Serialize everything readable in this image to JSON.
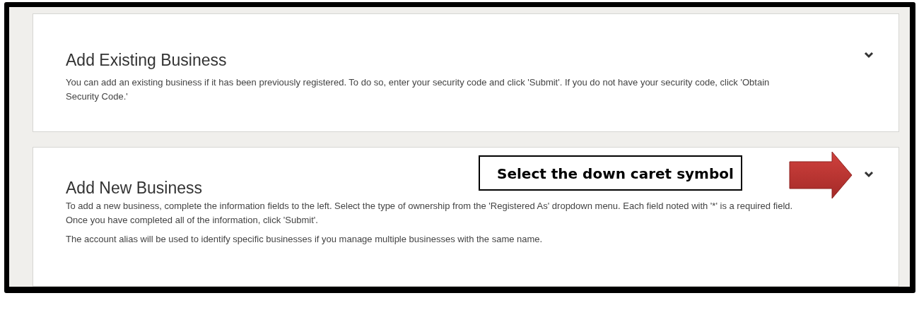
{
  "panels": [
    {
      "title": "Add Existing Business",
      "paragraphs": [
        "You can add an existing business if it has been previously registered. To do so, enter your security code and click 'Submit'. If you do not have your security code, click 'Obtain Security Code.'"
      ],
      "expanded": false
    },
    {
      "title": "Add New Business",
      "paragraphs": [
        "To add a new business, complete the information fields to the left. Select the type of ownership from the 'Registered As' dropdown menu. Each field noted with '*' is a required field. Once you have completed all of the information, click 'Submit'.",
        "The account alias will be used to identify specific businesses if you manage multiple businesses with the same name."
      ],
      "expanded": false,
      "callout": "Select the down caret symbol"
    }
  ]
}
